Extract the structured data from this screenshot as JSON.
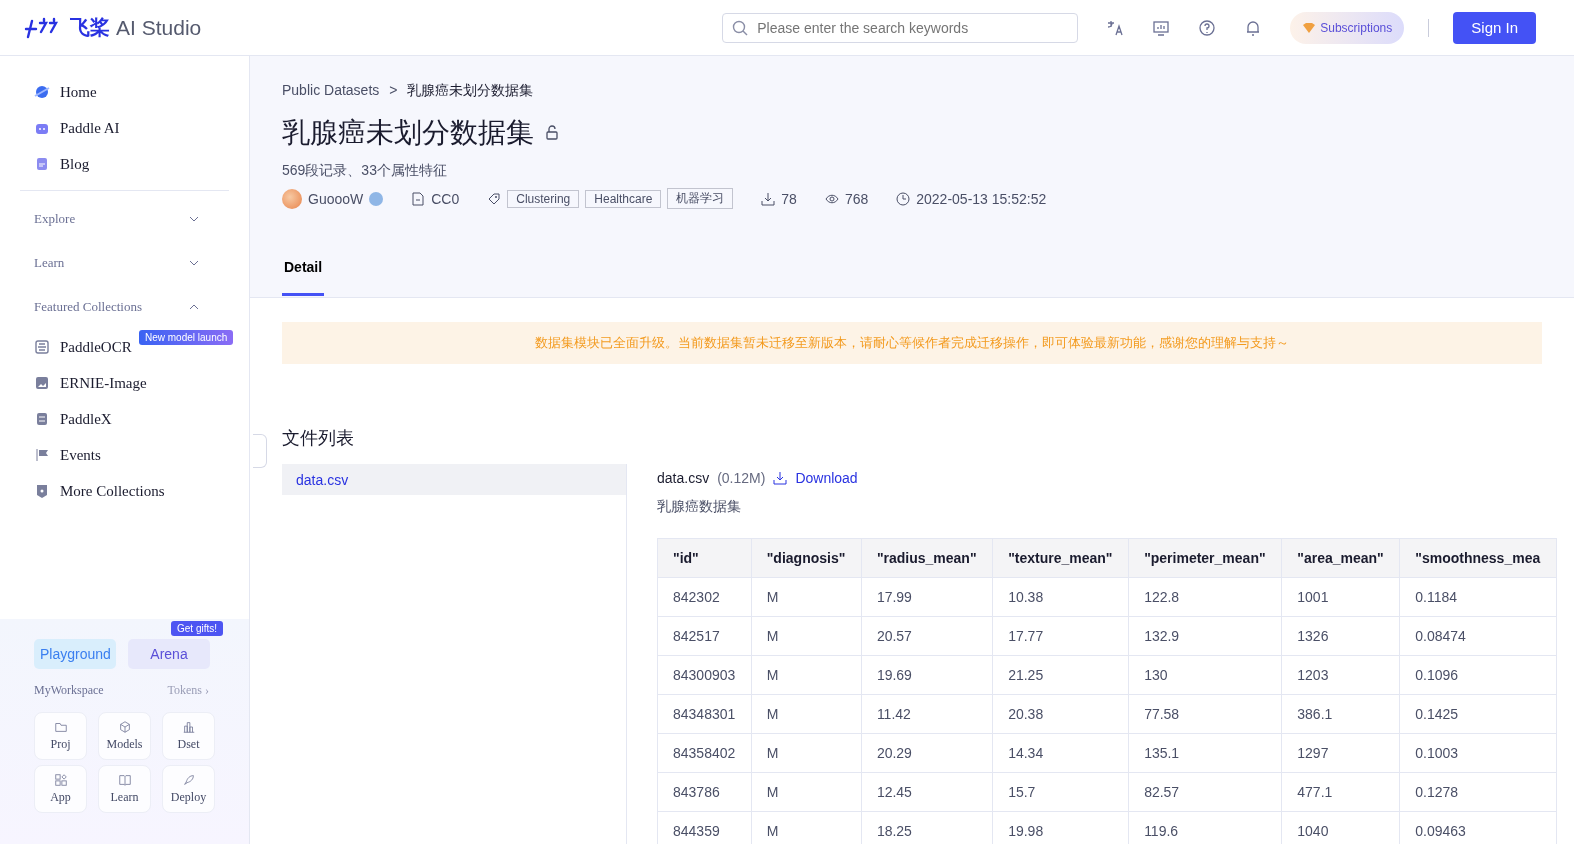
{
  "header": {
    "logo_cn": "飞桨",
    "logo_text": "AI Studio",
    "search": {
      "placeholder": "Please enter the search keywords"
    },
    "subscriptions": "Subscriptions",
    "sign_in": "Sign In"
  },
  "sidebar": {
    "items": [
      {
        "label": "Home"
      },
      {
        "label": "Paddle AI"
      },
      {
        "label": "Blog"
      }
    ],
    "sections": [
      {
        "label": "Explore",
        "expanded": false
      },
      {
        "label": "Learn",
        "expanded": false
      },
      {
        "label": "Featured Collections",
        "expanded": true,
        "items": [
          {
            "label": "PaddleOCR",
            "badge": "New model launch"
          },
          {
            "label": "ERNIE-Image"
          },
          {
            "label": "PaddleX"
          },
          {
            "label": "Events"
          },
          {
            "label": "More Collections"
          }
        ]
      }
    ],
    "playground": "Playground",
    "arena": "Arena",
    "arena_badge": "Get gifts!",
    "workspace": "MyWorkspace",
    "tokens": "Tokens",
    "tokens_arrow": "›",
    "tools": [
      {
        "label": "Proj"
      },
      {
        "label": "Models"
      },
      {
        "label": "Dset"
      },
      {
        "label": "App"
      },
      {
        "label": "Learn"
      },
      {
        "label": "Deploy"
      }
    ]
  },
  "breadcrumb": [
    "Public Datasets",
    "乳腺癌未划分数据集"
  ],
  "breadcrumb_separator": ">",
  "title": "乳腺癌未划分数据集",
  "subtitle": "569段记录、33个属性特征",
  "meta": {
    "author": "GuoooW",
    "license": "CC0",
    "tags": [
      "Clustering",
      "Healthcare",
      "机器学习"
    ],
    "downloads": "78",
    "views": "768",
    "date": "2022-05-13 15:52:52"
  },
  "tabs": [
    {
      "label": "Detail",
      "selected": true
    }
  ],
  "notice": "数据集模块已全面升级。当前数据集暂未迁移至新版本，请耐心等候作者完成迁移操作，即可体验最新功能，感谢您的理解与支持～",
  "files_title": "文件列表",
  "files": [
    {
      "name": "data.csv",
      "selected": true
    }
  ],
  "file_detail": {
    "name": "data.csv",
    "size": "(0.12M)",
    "download": "Download",
    "description": "乳腺癌数据集"
  },
  "table": {
    "columns": [
      "\"id\"",
      "\"diagnosis\"",
      "\"radius_mean\"",
      "\"texture_mean\"",
      "\"perimeter_mean\"",
      "\"area_mean\"",
      "\"smoothness_mea"
    ],
    "rows": [
      [
        "842302",
        "M",
        "17.99",
        "10.38",
        "122.8",
        "1001",
        "0.1184"
      ],
      [
        "842517",
        "M",
        "20.57",
        "17.77",
        "132.9",
        "1326",
        "0.08474"
      ],
      [
        "84300903",
        "M",
        "19.69",
        "21.25",
        "130",
        "1203",
        "0.1096"
      ],
      [
        "84348301",
        "M",
        "11.42",
        "20.38",
        "77.58",
        "386.1",
        "0.1425"
      ],
      [
        "84358402",
        "M",
        "20.29",
        "14.34",
        "135.1",
        "1297",
        "0.1003"
      ],
      [
        "843786",
        "M",
        "12.45",
        "15.7",
        "82.57",
        "477.1",
        "0.1278"
      ],
      [
        "844359",
        "M",
        "18.25",
        "19.98",
        "119.6",
        "1040",
        "0.09463"
      ]
    ]
  }
}
